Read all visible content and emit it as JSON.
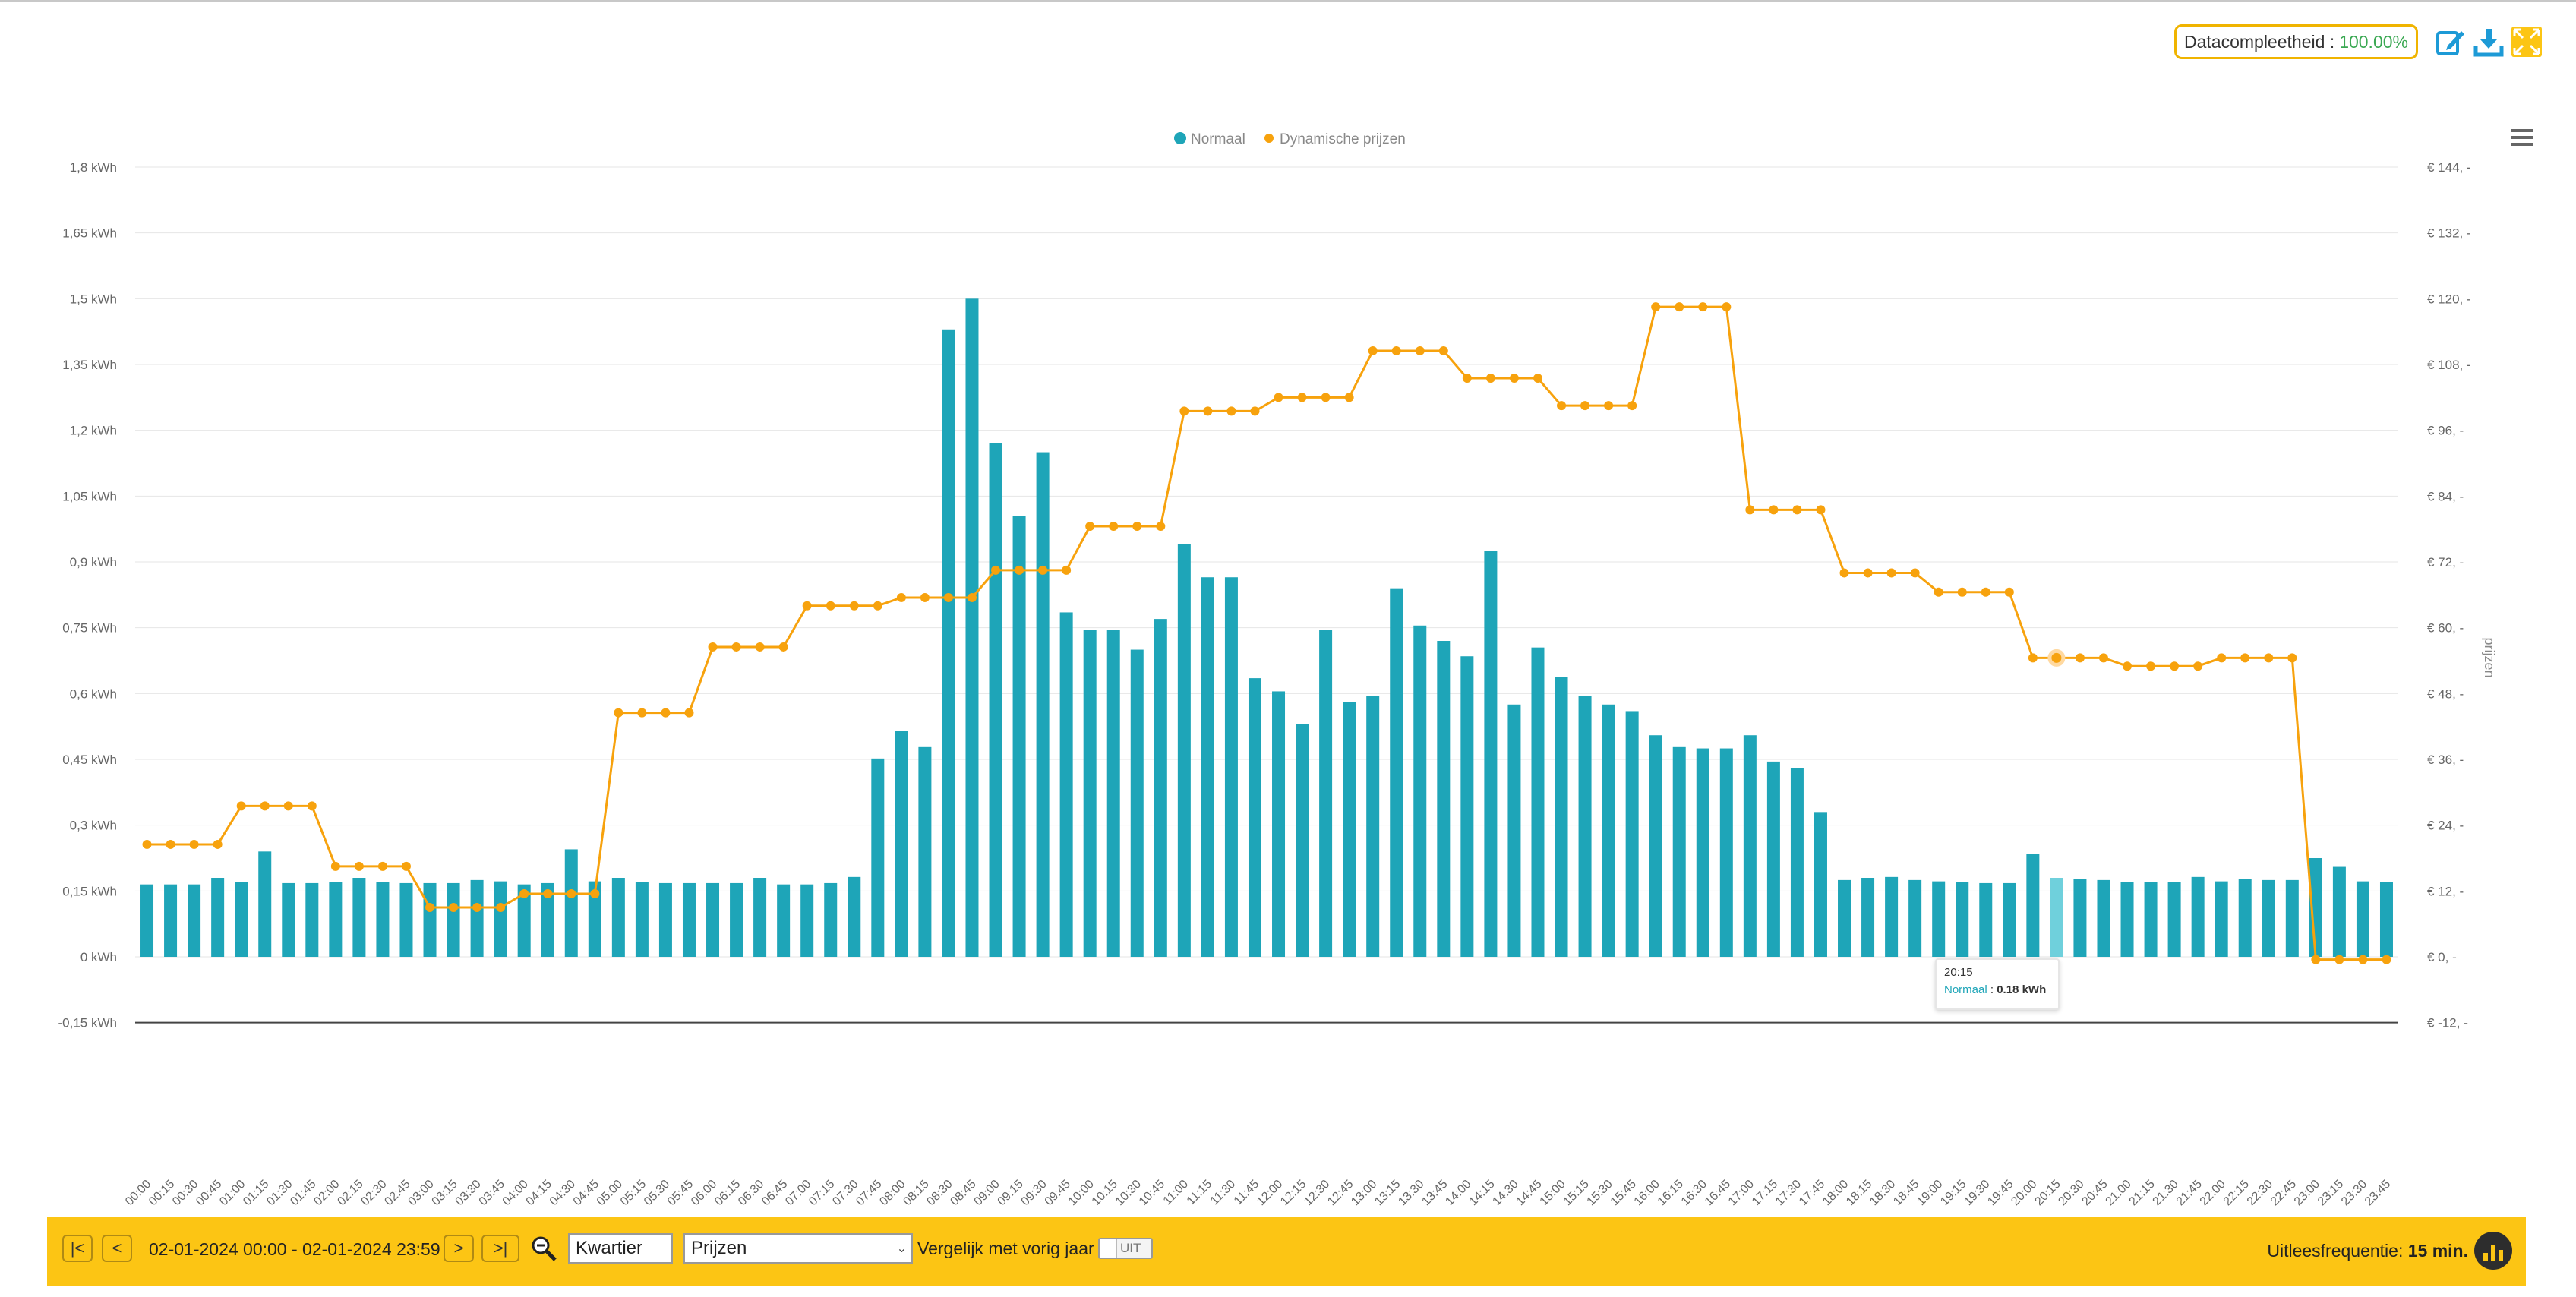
{
  "header": {
    "completeness_label": "Datacompleetheid :",
    "completeness_value": "100.00%",
    "icons": [
      "edit-icon",
      "download-icon",
      "fullscreen-icon"
    ]
  },
  "chart_data": {
    "type": "bar",
    "legend": [
      "Normaal",
      "Dynamische prijzen"
    ],
    "legend_position": "top-center",
    "grid": true,
    "y_left_ticks": [
      "-0,15 kWh",
      "0 kWh",
      "0,15 kWh",
      "0,3 kWh",
      "0,45 kWh",
      "0,6 kWh",
      "0,75 kWh",
      "0,9 kWh",
      "1,05 kWh",
      "1,2 kWh",
      "1,35 kWh",
      "1,5 kWh",
      "1,65 kWh",
      "1,8 kWh"
    ],
    "y_left_range": [
      -0.15,
      1.8
    ],
    "y_right_ticks": [
      "€ -12, -",
      "€ 0, -",
      "€ 12, -",
      "€ 24, -",
      "€ 36, -",
      "€ 48, -",
      "€ 60, -",
      "€ 72, -",
      "€ 84, -",
      "€ 96, -",
      "€ 108, -",
      "€ 120, -",
      "€ 132, -",
      "€ 144, -"
    ],
    "y_right_range": [
      -12,
      144
    ],
    "y_right_label": "prijzen",
    "colors": {
      "bars": "#1ea5b8",
      "line": "#f7a20d",
      "highlight_bar": "#6fd0dc"
    },
    "categories": [
      "00:00",
      "00:15",
      "00:30",
      "00:45",
      "01:00",
      "01:15",
      "01:30",
      "01:45",
      "02:00",
      "02:15",
      "02:30",
      "02:45",
      "03:00",
      "03:15",
      "03:30",
      "03:45",
      "04:00",
      "04:15",
      "04:30",
      "04:45",
      "05:00",
      "05:15",
      "05:30",
      "05:45",
      "06:00",
      "06:15",
      "06:30",
      "06:45",
      "07:00",
      "07:15",
      "07:30",
      "07:45",
      "08:00",
      "08:15",
      "08:30",
      "08:45",
      "09:00",
      "09:15",
      "09:30",
      "09:45",
      "10:00",
      "10:15",
      "10:30",
      "10:45",
      "11:00",
      "11:15",
      "11:30",
      "11:45",
      "12:00",
      "12:15",
      "12:30",
      "12:45",
      "13:00",
      "13:15",
      "13:30",
      "13:45",
      "14:00",
      "14:15",
      "14:30",
      "14:45",
      "15:00",
      "15:15",
      "15:30",
      "15:45",
      "16:00",
      "16:15",
      "16:30",
      "16:45",
      "17:00",
      "17:15",
      "17:30",
      "17:45",
      "18:00",
      "18:15",
      "18:30",
      "18:45",
      "19:00",
      "19:15",
      "19:30",
      "19:45",
      "20:00",
      "20:15",
      "20:30",
      "20:45",
      "21:00",
      "21:15",
      "21:30",
      "21:45",
      "22:00",
      "22:15",
      "22:30",
      "22:45",
      "23:00",
      "23:15",
      "23:30",
      "23:45"
    ],
    "series": [
      {
        "name": "Normaal",
        "type": "bar",
        "values": [
          0.165,
          0.165,
          0.165,
          0.18,
          0.17,
          0.24,
          0.168,
          0.168,
          0.17,
          0.18,
          0.17,
          0.168,
          0.168,
          0.168,
          0.175,
          0.172,
          0.165,
          0.168,
          0.245,
          0.172,
          0.18,
          0.17,
          0.168,
          0.168,
          0.168,
          0.168,
          0.18,
          0.165,
          0.165,
          0.168,
          0.182,
          0.452,
          0.515,
          0.478,
          1.43,
          1.5,
          1.17,
          1.005,
          1.15,
          0.785,
          0.745,
          0.745,
          0.7,
          0.77,
          0.94,
          0.865,
          0.865,
          0.635,
          0.605,
          0.53,
          0.745,
          0.58,
          0.595,
          0.84,
          0.755,
          0.72,
          0.685,
          0.925,
          0.575,
          0.705,
          0.638,
          0.595,
          0.575,
          0.56,
          0.505,
          0.478,
          0.475,
          0.475,
          0.505,
          0.445,
          0.43,
          0.33,
          0.175,
          0.18,
          0.182,
          0.175,
          0.172,
          0.17,
          0.168,
          0.168,
          0.235,
          0.18,
          0.178,
          0.175,
          0.17,
          0.17,
          0.17,
          0.182,
          0.172,
          0.178,
          0.175,
          0.175,
          0.225,
          0.205,
          0.172,
          0.17
        ]
      },
      {
        "name": "Dynamische prijzen",
        "type": "line",
        "values": [
          20.5,
          20.5,
          20.5,
          20.5,
          27.5,
          27.5,
          27.5,
          27.5,
          16.5,
          16.5,
          16.5,
          16.5,
          9,
          9,
          9,
          9,
          11.5,
          11.5,
          11.5,
          11.5,
          44.5,
          44.5,
          44.5,
          44.5,
          56.5,
          56.5,
          56.5,
          56.5,
          64,
          64,
          64,
          64,
          65.5,
          65.5,
          65.5,
          65.5,
          70.5,
          70.5,
          70.5,
          70.5,
          78.5,
          78.5,
          78.5,
          78.5,
          99.5,
          99.5,
          99.5,
          99.5,
          102,
          102,
          102,
          102,
          110.5,
          110.5,
          110.5,
          110.5,
          105.5,
          105.5,
          105.5,
          105.5,
          100.5,
          100.5,
          100.5,
          100.5,
          118.5,
          118.5,
          118.5,
          118.5,
          81.5,
          81.5,
          81.5,
          81.5,
          70,
          70,
          70,
          70,
          66.5,
          66.5,
          66.5,
          66.5,
          54.5,
          54.5,
          54.5,
          54.5,
          53,
          53,
          53,
          53,
          54.5,
          54.5,
          54.5,
          54.5,
          -0.5,
          -0.5,
          -0.5,
          -0.5
        ]
      }
    ],
    "tooltip": {
      "time": "20:15",
      "series": "Normaal",
      "value": "0.18 kWh"
    }
  },
  "footer": {
    "first_label": "|<",
    "prev_label": "<",
    "date_range": "02-01-2024 00:00 - 02-01-2024 23:59",
    "next_label": ">",
    "last_label": ">|",
    "period_select": "Kwartier",
    "data_select": "Prijzen",
    "compare_label": "Vergelijk met vorig jaar",
    "toggle_label": "UIT",
    "frequency_label": "Uitleesfrequentie:",
    "frequency_value": "15 min."
  }
}
